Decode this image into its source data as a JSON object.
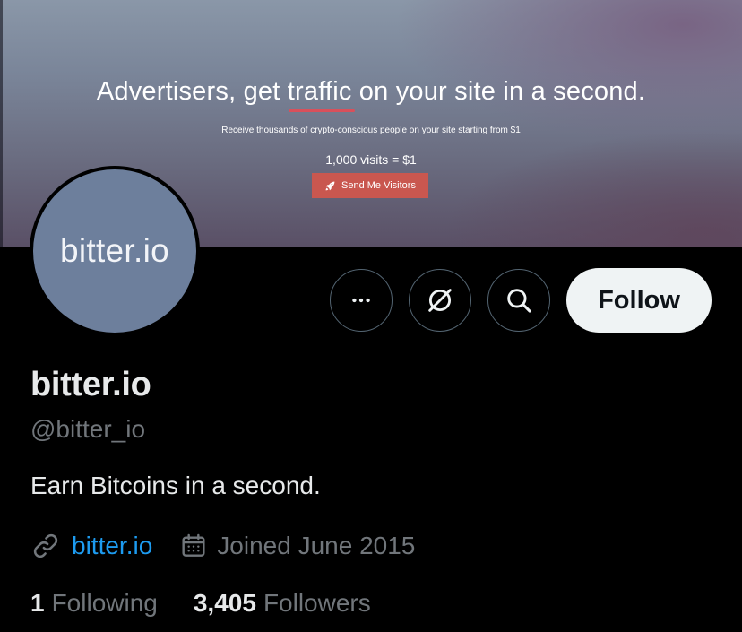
{
  "banner": {
    "headline": "Advertisers, get traffic on your site in a second.",
    "subline_prefix": "Receive thousands of ",
    "subline_link": "crypto-conscious",
    "subline_suffix": " people on your site starting from $1",
    "price": "1,000 visits = $1",
    "cta_label": "Send Me Visitors",
    "cta_color": "#c9574f",
    "accent_underline_color": "#d9505b"
  },
  "avatar": {
    "text": "bitter.io",
    "background": "#6d7f9c"
  },
  "actions": {
    "more_icon": "more-horizontal-icon",
    "grok_icon": "grok-icon",
    "search_icon": "search-icon",
    "follow_label": "Follow"
  },
  "profile": {
    "display_name": "bitter.io",
    "handle": "@bitter_io",
    "bio": "Earn Bitcoins in a second.",
    "website_label": "bitter.io",
    "joined": "Joined June 2015"
  },
  "stats": {
    "following_count": "1",
    "following_label": "Following",
    "followers_count": "3,405",
    "followers_label": "Followers"
  },
  "colors": {
    "background": "#000000",
    "text_primary": "#e7e9ea",
    "text_secondary": "#71767b",
    "link": "#1d9bf0",
    "border": "#536471",
    "follow_bg": "#eff3f4"
  }
}
